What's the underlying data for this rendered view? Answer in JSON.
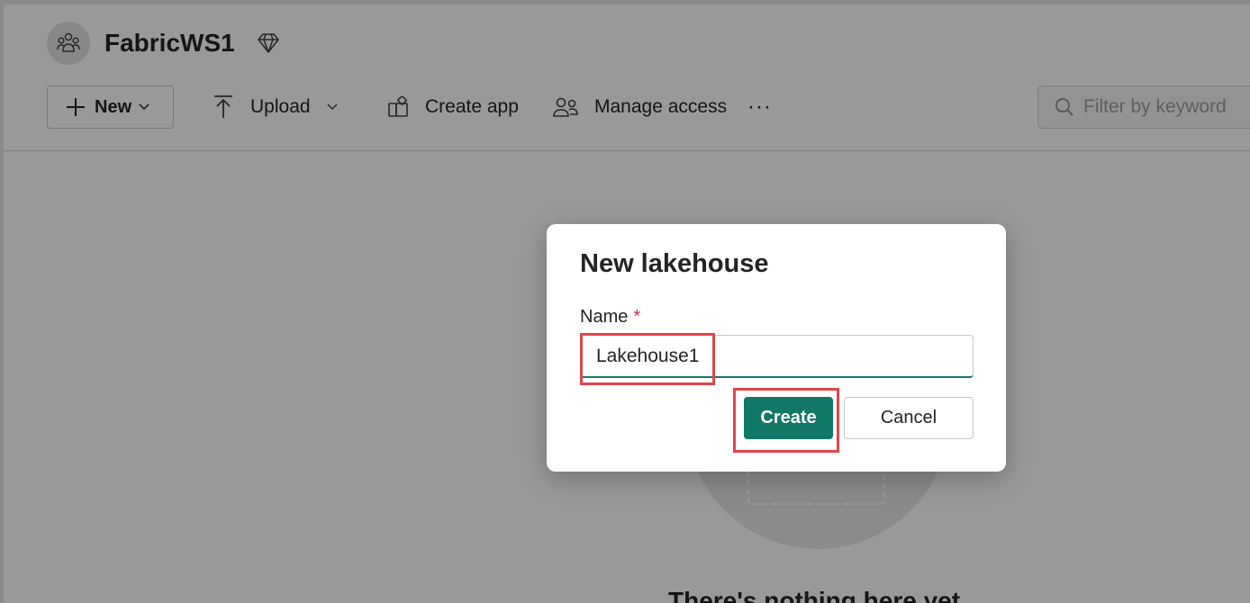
{
  "workspace": {
    "title": "FabricWS1",
    "avatar_icon": "people-group-icon",
    "premium_icon": "diamond-icon"
  },
  "toolbar": {
    "new_label": "New",
    "upload_label": "Upload",
    "create_app_label": "Create app",
    "manage_access_label": "Manage access",
    "more_label": "···",
    "filter_placeholder": "Filter by keyword"
  },
  "empty_state": {
    "text": "There's nothing here yet"
  },
  "dialog": {
    "title": "New lakehouse",
    "name_label": "Name",
    "required_mark": "*",
    "name_value": "Lakehouse1",
    "create_label": "Create",
    "cancel_label": "Cancel"
  },
  "colors": {
    "primary": "#117865",
    "highlight": "#e0454a",
    "required": "#c4314b"
  }
}
